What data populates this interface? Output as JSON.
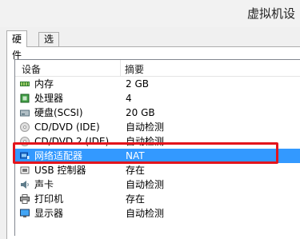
{
  "window": {
    "title": "虚拟机设"
  },
  "tabs": [
    {
      "label": "硬件"
    },
    {
      "label": "选项"
    }
  ],
  "columns": {
    "device": "设备",
    "summary": "摘要"
  },
  "devices": [
    {
      "name": "内存",
      "summary": "2 GB",
      "icon": "memory-icon"
    },
    {
      "name": "处理器",
      "summary": "4",
      "icon": "processor-icon"
    },
    {
      "name": "硬盘(SCSI)",
      "summary": "20 GB",
      "icon": "hard-disk-icon"
    },
    {
      "name": "CD/DVD (IDE)",
      "summary": "自动检测",
      "icon": "cd-dvd-icon"
    },
    {
      "name": "CD/DVD 2 (IDE)",
      "summary": "自动检测",
      "icon": "cd-dvd-icon"
    },
    {
      "name": "网络适配器",
      "summary": "NAT",
      "icon": "network-adapter-icon"
    },
    {
      "name": "USB 控制器",
      "summary": "存在",
      "icon": "usb-controller-icon"
    },
    {
      "name": "声卡",
      "summary": "自动检测",
      "icon": "sound-card-icon"
    },
    {
      "name": "打印机",
      "summary": "存在",
      "icon": "printer-icon"
    },
    {
      "name": "显示器",
      "summary": "自动检测",
      "icon": "display-icon"
    }
  ],
  "colors": {
    "selection": "#3399ff",
    "highlight_box": "#e3141c"
  }
}
